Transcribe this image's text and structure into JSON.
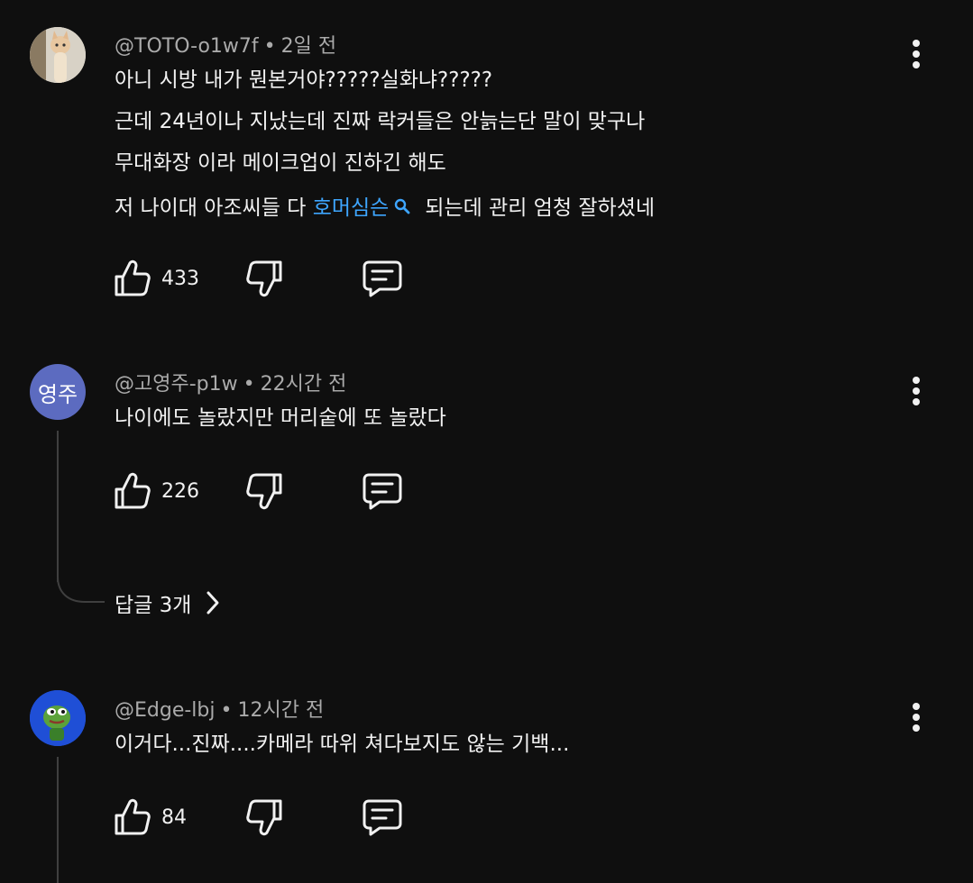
{
  "comments": [
    {
      "author": "@TOTO-o1w7f",
      "time": "2일 전",
      "lines": [
        "아니 시방 내가 뭔본거야?????실화냐?????",
        "근데 24년이나 지났는데 진짜 락커들은 안늙는단 말이 맞구나",
        "무대화장 이라 메이크업이 진하긴 해도"
      ],
      "last_line_prefix": "저 나이대 아조씨들 다 ",
      "last_line_link": "호머심슨",
      "last_line_suffix": "되는데 관리 엄청 잘하셨네",
      "likes": "433",
      "avatar_icon": "cat-photo-avatar"
    },
    {
      "author": "@고영주-p1w",
      "time": "22시간 전",
      "text": "나이에도 놀랐지만 머리숱에 또 놀랐다",
      "likes": "226",
      "avatar_text": "영주",
      "avatar_color": "#5c6bc0",
      "replies_label": "답글 3개"
    },
    {
      "author": "@Edge-lbj",
      "time": "12시간 전",
      "text": "이거다...진짜....카메라 따위 쳐다보지도 않는 기백...",
      "likes": "84",
      "avatar_icon": "pepe-frog-avatar"
    }
  ],
  "colors": {
    "background": "#0f0f0f",
    "link": "#3ea6ff",
    "meta": "#aaaaaa",
    "thread_line": "#3f3f3f"
  },
  "icons": [
    "thumbs-up-icon",
    "thumbs-down-icon",
    "reply-icon",
    "more-vert-icon",
    "search-icon",
    "chevron-right-icon"
  ]
}
